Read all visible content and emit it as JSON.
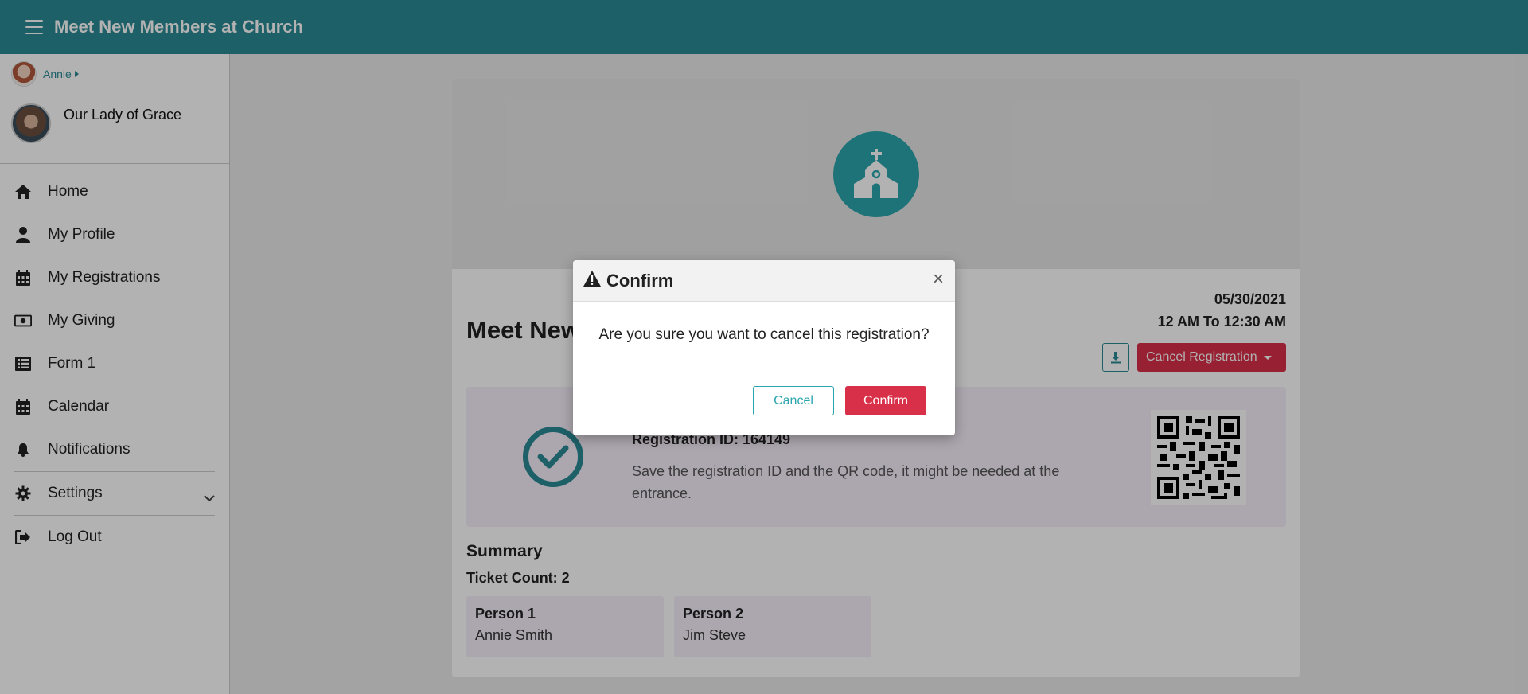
{
  "header": {
    "title": "Meet New Members at Church"
  },
  "sidebar": {
    "user": {
      "name": "Annie"
    },
    "church": {
      "name": "Our Lady of Grace"
    },
    "items": [
      {
        "label": "Home",
        "icon": "home-icon"
      },
      {
        "label": "My Profile",
        "icon": "user-icon"
      },
      {
        "label": "My Registrations",
        "icon": "calendar-icon"
      },
      {
        "label": "My Giving",
        "icon": "money-bill-icon"
      },
      {
        "label": "Form 1",
        "icon": "list-icon"
      },
      {
        "label": "Calendar",
        "icon": "calendar-icon"
      },
      {
        "label": "Notifications",
        "icon": "bell-icon"
      },
      {
        "label": "Settings",
        "icon": "gear-icon"
      },
      {
        "label": "Log Out",
        "icon": "sign-out-icon"
      }
    ]
  },
  "event": {
    "title": "Meet New",
    "date": "05/30/2021",
    "time": "12 AM To 12:30 AM",
    "cancel_label": "Cancel Registration",
    "registration_id": "Registration ID: 164149",
    "note": "Save the registration ID and the QR code, it might be needed at the entrance."
  },
  "summary": {
    "title": "Summary",
    "ticket_count": "Ticket Count: 2",
    "persons": [
      {
        "label": "Person 1",
        "name": "Annie Smith"
      },
      {
        "label": "Person 2",
        "name": "Jim Steve"
      }
    ]
  },
  "modal": {
    "title": "Confirm",
    "message": "Are you sure you want to cancel this registration?",
    "cancel_label": "Cancel",
    "confirm_label": "Confirm"
  },
  "colors": {
    "brand": "#2a8a95",
    "danger": "#d9304a",
    "accent": "#2aa5ad"
  }
}
